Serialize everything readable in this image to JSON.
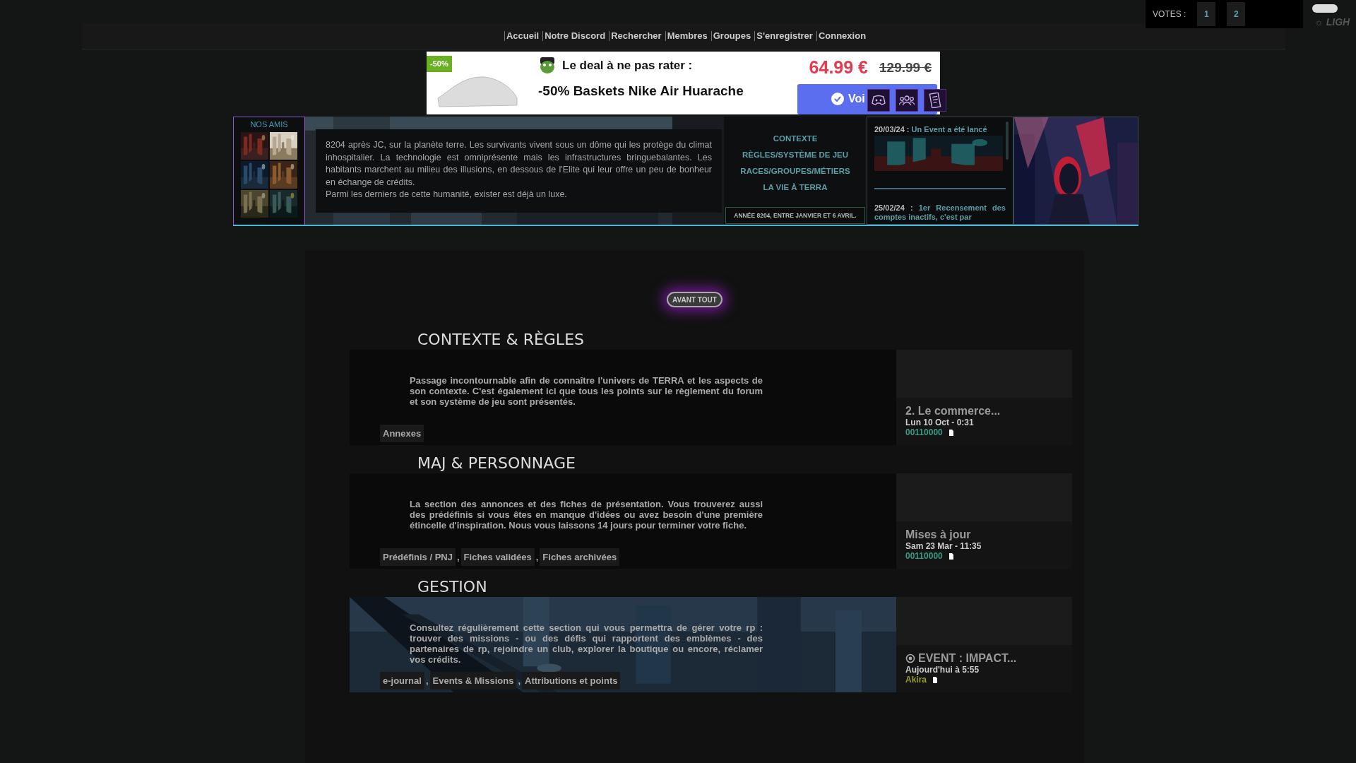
{
  "votes": {
    "label": "VOTES :",
    "buttons": [
      "1",
      "2"
    ]
  },
  "theme_toggle": {
    "label": "☼ LIGH"
  },
  "nav": [
    "Accueil",
    "Notre Discord",
    "Rechercher",
    "Membres",
    "Groupes",
    "S'enregistrer",
    "Connexion"
  ],
  "ad": {
    "badge": "-50%",
    "headline": "Le deal à ne pas rater :",
    "product": "-50% Baskets Nike Air Huarache",
    "price": "64.99 €",
    "old_price": "129.99 €",
    "button": "Voi"
  },
  "friends": {
    "title": "NOS AMIS"
  },
  "intro": {
    "paragraphs": [
      "8204 après JC, sur la planète terre. Les survivants vivent sous un dôme qui les protège du climat inhospitalier. La technologie est omniprésente mais les infrastructures bringuebalantes. Les habitants marchent au milieu des illusions, en dessous de l'Elite qui leur offre un peu de bonheur en échange de crédits.",
      "Parmi les derniers de cette humanité, exister est déjà un luxe."
    ]
  },
  "lore_links": [
    "CONTEXTE",
    "RÈGLES/SYSTÈME DE JEU",
    "RACES/GROUPES/MÉTIERS",
    "LA VIE À TERRA"
  ],
  "year_banner": "ANNÉE 8204, ENTRE JANVIER ET 6 AVRIL.",
  "news": [
    {
      "date": "20/03/24 :",
      "text": "Un Event a été lancé"
    },
    {
      "date": "25/02/24 :",
      "text": "1er Recensement des comptes inactifs, c'est par"
    }
  ],
  "intro_button": "AVANT TOUT",
  "categories": [
    {
      "title": "CONTEXTE & RÈGLES",
      "kind": "plain",
      "description": "Passage incontournable afin de connaître l'univers de TERRA et les aspects de son contexte. C'est également ici que tous les points sur le règlement du forum et son système de jeu sont présentés.",
      "subforums": [
        "Annexes"
      ],
      "last_post": {
        "kind": "plain",
        "title": "2. Le commerce...",
        "date": "Lun 10 Oct - 0:31",
        "author": "00110000",
        "color": "#3a9a86"
      }
    },
    {
      "title": "MAJ & PERSONNAGE",
      "kind": "plain",
      "description": "La section des annonces et des fiches de présentation. Vous trouverez aussi des prédéfinis si vous êtes en manque d'idées ou avez besoin d'une première étincelle d'inspiration. Nous vous laissons 14 jours pour terminer votre fiche.",
      "subforums": [
        "Prédéfinis / PNJ",
        "Fiches validées",
        "Fiches archivées"
      ],
      "separator": ",",
      "last_post": {
        "kind": "plain",
        "title": "Mises à jour",
        "date": "Sam 23 Mar - 11:35",
        "author": "00110000",
        "color": "#3a9a86"
      }
    },
    {
      "title": "GESTION",
      "kind": "picture",
      "description": "Consultez régulièrement cette section qui vous permettra de gérer votre rp : trouver des missions - ou des défis qui rapportent des emblèmes - des partenaires de rp, rejoindre un club, explorer la boutique ou encore, réclamer vos crédits.",
      "subforums": [
        "e-journal",
        "Events & Missions",
        "Attributions et points"
      ],
      "separator": ",",
      "last_post": {
        "kind": "event",
        "title": "EVENT : IMPACT...",
        "date": "Aujourd'hui à 5:55",
        "author": "Akira",
        "color": "#9a9c2a"
      }
    }
  ]
}
